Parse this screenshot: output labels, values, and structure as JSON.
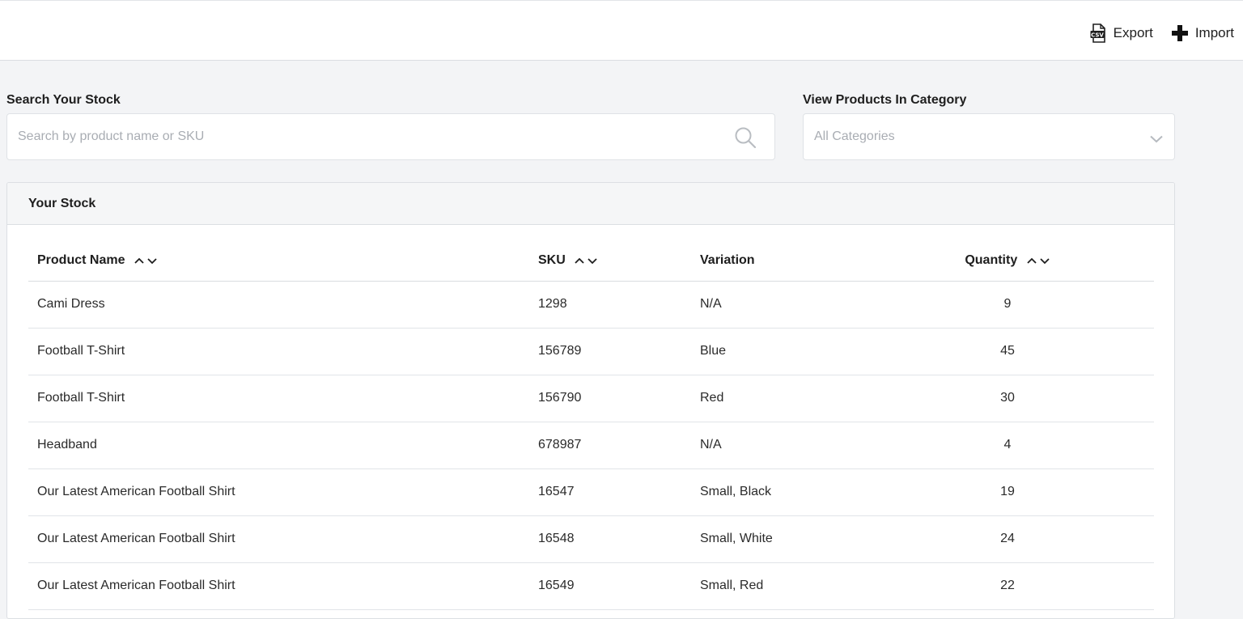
{
  "toolbar": {
    "export_label": "Export",
    "export_icon": "csv-file-icon",
    "import_label": "Import",
    "import_icon": "plus-icon"
  },
  "search": {
    "label": "Search Your Stock",
    "placeholder": "Search by product name or SKU",
    "value": ""
  },
  "category": {
    "label": "View Products In Category",
    "selected": "All Categories"
  },
  "stock": {
    "title": "Your Stock",
    "columns": [
      "Product Name",
      "SKU",
      "Variation",
      "Quantity"
    ],
    "rows": [
      {
        "name": "Cami Dress",
        "sku": "1298",
        "variation": "N/A",
        "quantity": "9"
      },
      {
        "name": "Football T-Shirt",
        "sku": "156789",
        "variation": "Blue",
        "quantity": "45"
      },
      {
        "name": "Football T-Shirt",
        "sku": "156790",
        "variation": "Red",
        "quantity": "30"
      },
      {
        "name": "Headband",
        "sku": "678987",
        "variation": "N/A",
        "quantity": "4"
      },
      {
        "name": "Our Latest American Football Shirt",
        "sku": "16547",
        "variation": "Small, Black",
        "quantity": "19"
      },
      {
        "name": "Our Latest American Football Shirt",
        "sku": "16548",
        "variation": "Small, White",
        "quantity": "24"
      },
      {
        "name": "Our Latest American Football Shirt",
        "sku": "16549",
        "variation": "Small, Red",
        "quantity": "22"
      }
    ]
  },
  "colors": {
    "page_bg": "#f3f4f6",
    "card_bg": "#ffffff",
    "border": "#dfe2e6",
    "placeholder": "#a9adb3",
    "text": "#1e1e1e"
  }
}
